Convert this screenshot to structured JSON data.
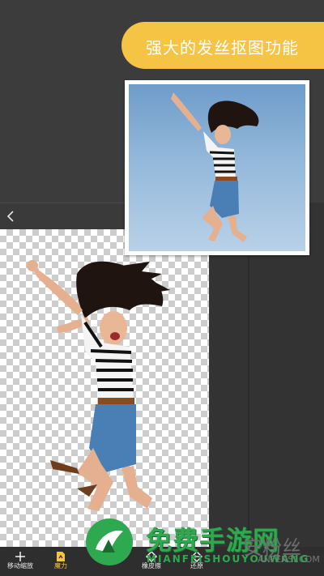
{
  "banner": {
    "text": "强大的发丝抠图功能"
  },
  "toolbar": {
    "tools": [
      {
        "label": "移动缩放",
        "icon": "move-icon"
      },
      {
        "label": "魔力",
        "icon": "magic-icon"
      },
      {
        "label": "",
        "icon": "brush-icon"
      },
      {
        "label": "橡皮擦",
        "icon": "eraser-icon"
      },
      {
        "label": "还原",
        "icon": "restore-icon"
      }
    ],
    "active_index": 1
  },
  "watermark": {
    "text": "免费手游网",
    "subtext": "MIANFEISHOUYOUWANG",
    "brand": "安粉丝",
    "brand_sub": "ANFENSI.COM"
  },
  "colors": {
    "accent": "#f6c444",
    "background": "#3c3c3c",
    "watermark_green": "#2fa94f"
  }
}
